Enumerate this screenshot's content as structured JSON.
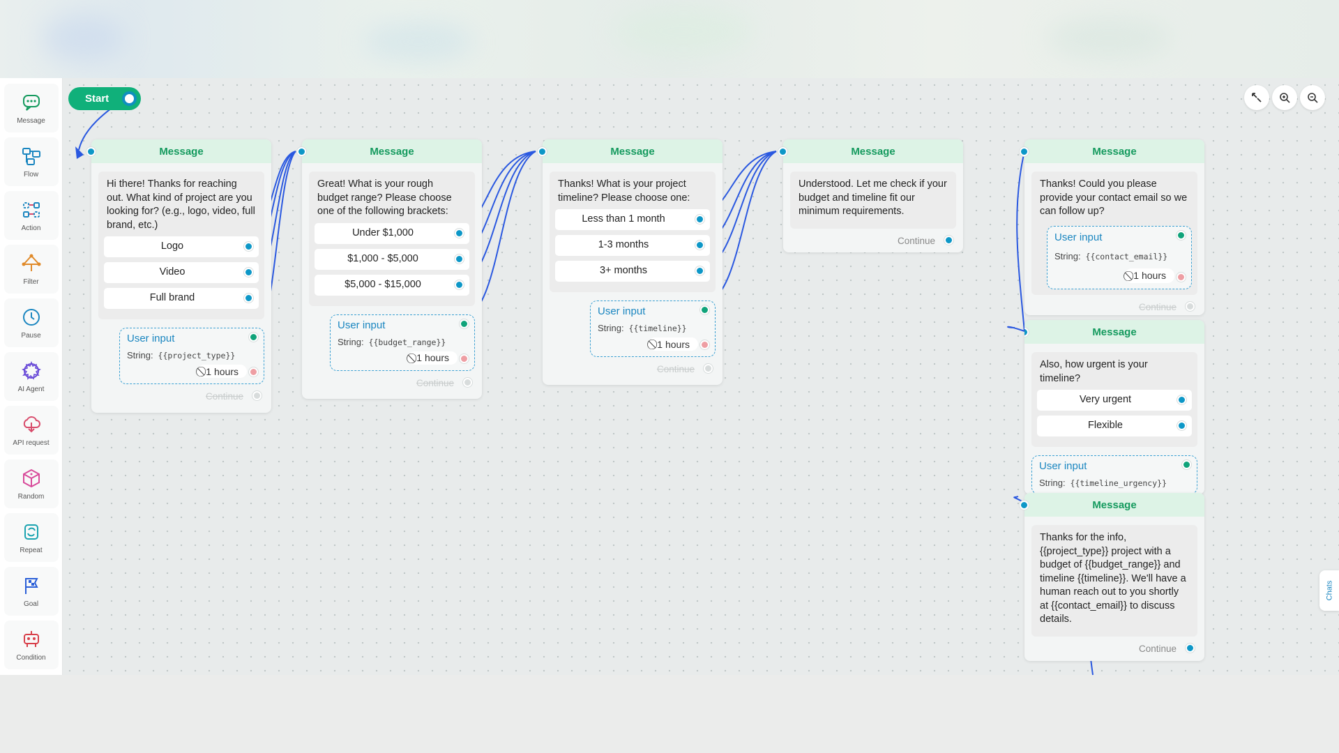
{
  "sidebar": {
    "items": [
      {
        "label": "Message",
        "icon": "message-icon"
      },
      {
        "label": "Flow",
        "icon": "flow-icon"
      },
      {
        "label": "Action",
        "icon": "action-icon"
      },
      {
        "label": "Filter",
        "icon": "filter-icon"
      },
      {
        "label": "Pause",
        "icon": "pause-icon"
      },
      {
        "label": "AI Agent",
        "icon": "ai-agent-icon"
      },
      {
        "label": "API request",
        "icon": "api-request-icon"
      },
      {
        "label": "Random",
        "icon": "random-icon"
      },
      {
        "label": "Repeat",
        "icon": "repeat-icon"
      },
      {
        "label": "Goal",
        "icon": "goal-icon"
      },
      {
        "label": "Condition",
        "icon": "condition-icon"
      }
    ]
  },
  "start": {
    "label": "Start"
  },
  "chats_tab": {
    "label": "Chats"
  },
  "colors": {
    "accent_green": "#10b07a",
    "port_blue": "#0d97c7",
    "header_green": "#159a5e",
    "timeout_pink": "#ee9ea3"
  },
  "nodes": [
    {
      "title": "Message",
      "text": "Hi there! Thanks for reaching out. What kind of project are you looking for? (e.g., logo, video, full brand, etc.)",
      "choices": [
        "Logo",
        "Video",
        "Full brand"
      ],
      "user_input": {
        "title": "User input",
        "type": "String:",
        "var": "{{project_type}}",
        "timeout": "1 hours"
      },
      "continue": "Continue"
    },
    {
      "title": "Message",
      "text": "Great! What is your rough budget range? Please choose one of the following brackets:",
      "choices": [
        "Under $1,000",
        "$1,000 - $5,000",
        "$5,000 - $15,000"
      ],
      "user_input": {
        "title": "User input",
        "type": "String:",
        "var": "{{budget_range}}",
        "timeout": "1 hours"
      },
      "continue": "Continue"
    },
    {
      "title": "Message",
      "text": "Thanks! What is your project timeline? Please choose one:",
      "choices": [
        "Less than 1 month",
        "1-3 months",
        "3+ months"
      ],
      "user_input": {
        "title": "User input",
        "type": "String:",
        "var": "{{timeline}}",
        "timeout": "1 hours"
      },
      "continue": "Continue"
    },
    {
      "title": "Message",
      "text": "Understood. Let me check if your budget and timeline fit our minimum requirements.",
      "continue": "Continue"
    },
    {
      "title": "Message",
      "text": "Thanks! Could you please provide your contact email so we can follow up?",
      "user_input": {
        "title": "User input",
        "type": "String:",
        "var": "{{contact_email}}",
        "timeout": "1 hours"
      },
      "continue": "Continue"
    },
    {
      "title": "Message",
      "text": "Also, how urgent is your timeline?",
      "choices": [
        "Very urgent",
        "Flexible"
      ],
      "user_input": {
        "title": "User input",
        "type": "String:",
        "var": "{{timeline_urgency}}"
      }
    },
    {
      "title": "Message",
      "text": "Thanks for the info, {{project_type}} project with a budget of {{budget_range}} and timeline {{timeline}}. We'll have a human reach out to you shortly at {{contact_email}} to discuss details.",
      "continue": "Continue"
    }
  ]
}
